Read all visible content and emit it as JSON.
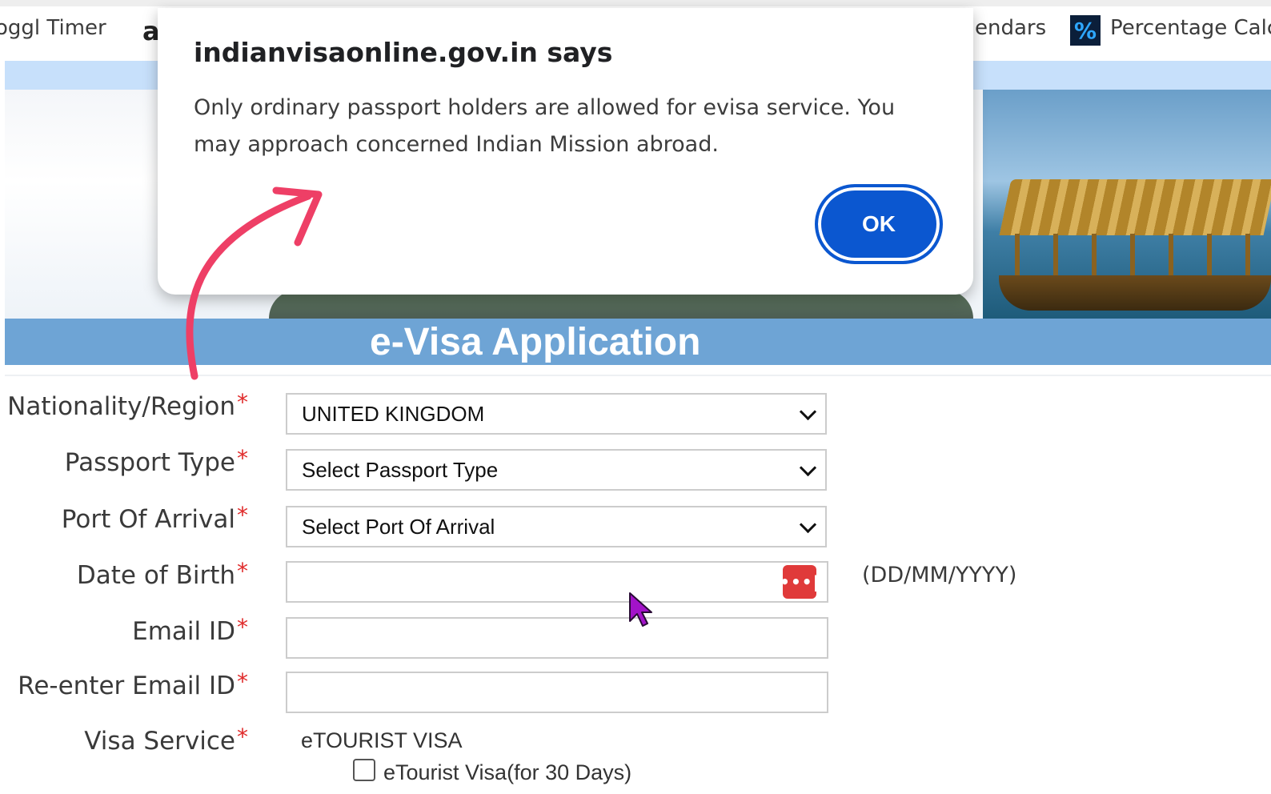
{
  "bookmarks": {
    "toggl_label": "oggl Timer",
    "amazon_icon": "a",
    "calendars_label": "endars",
    "percentage_icon": "%",
    "percentage_label": "Percentage Calc"
  },
  "page": {
    "title": "e-Visa Application"
  },
  "form": {
    "nationality": {
      "label": "Nationality/Region",
      "value": "UNITED KINGDOM"
    },
    "passport_type": {
      "label": "Passport Type",
      "value": "Select Passport Type"
    },
    "port_of_arrival": {
      "label": "Port Of Arrival",
      "value": "Select Port Of Arrival"
    },
    "date_of_birth": {
      "label": "Date of Birth",
      "value": "",
      "hint": "(DD/MM/YYYY)",
      "calendar_icon": "•••|"
    },
    "email": {
      "label": "Email ID",
      "value": ""
    },
    "reenter_email": {
      "label": "Re-enter Email ID",
      "value": ""
    },
    "visa_service": {
      "label": "Visa Service",
      "group": "eTOURIST VISA",
      "option_label": "eTourist Visa(for 30 Days)",
      "option_checked": false
    },
    "required_marker": "*"
  },
  "dialog": {
    "title": "indianvisaonline.gov.in says",
    "message": "Only ordinary passport holders are allowed for evisa service. You may approach concerned Indian Mission abroad.",
    "ok_label": "OK"
  },
  "colors": {
    "accent_blue": "#0b57d0",
    "title_bar": "#6ea4d5",
    "required_red": "#e02a2a",
    "annotation_arrow": "#ee3f66",
    "cursor": "#a313c9"
  }
}
